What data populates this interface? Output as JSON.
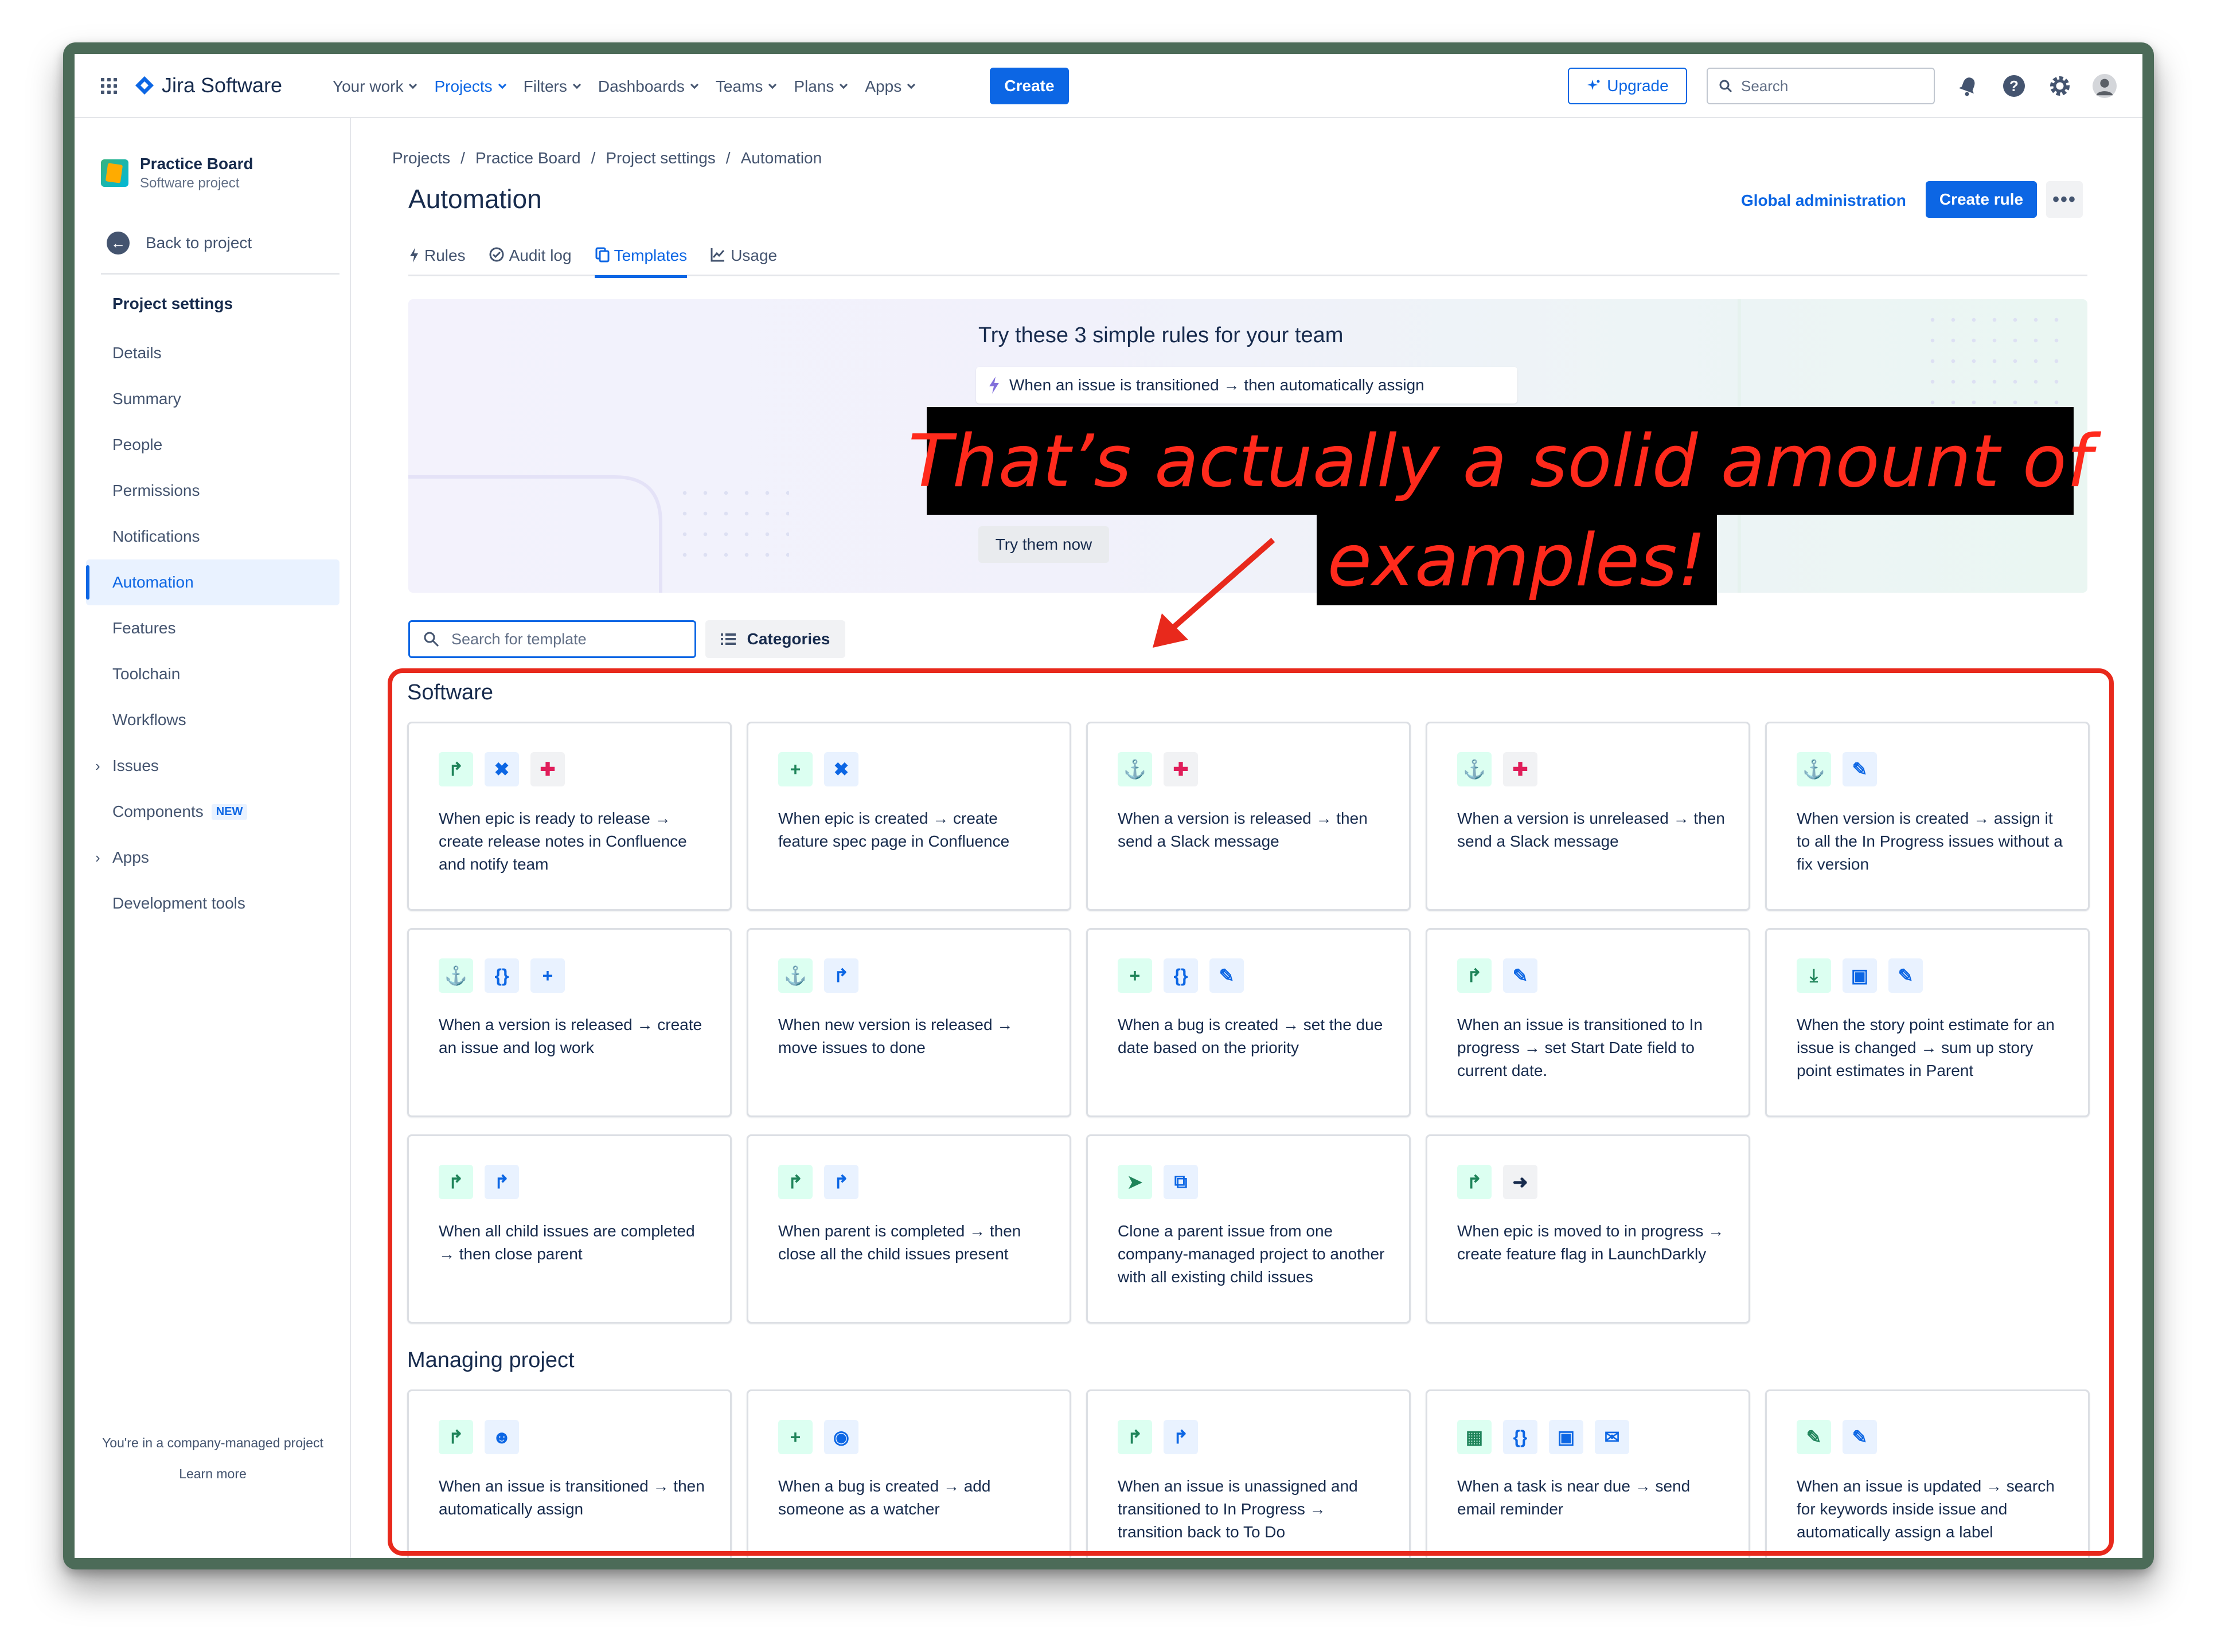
{
  "topnav": {
    "product_name": "Jira Software",
    "menu": [
      {
        "label": "Your work"
      },
      {
        "label": "Projects"
      },
      {
        "label": "Filters"
      },
      {
        "label": "Dashboards"
      },
      {
        "label": "Teams"
      },
      {
        "label": "Plans"
      },
      {
        "label": "Apps"
      }
    ],
    "create_label": "Create",
    "upgrade_label": "Upgrade",
    "search_placeholder": "Search"
  },
  "sidebar": {
    "project_name": "Practice Board",
    "project_type": "Software project",
    "back_label": "Back to project",
    "section_title": "Project settings",
    "items": [
      {
        "label": "Details"
      },
      {
        "label": "Summary"
      },
      {
        "label": "People"
      },
      {
        "label": "Permissions"
      },
      {
        "label": "Notifications"
      },
      {
        "label": "Automation"
      },
      {
        "label": "Features"
      },
      {
        "label": "Toolchain"
      },
      {
        "label": "Workflows"
      },
      {
        "label": "Issues"
      },
      {
        "label": "Components",
        "badge": "NEW"
      },
      {
        "label": "Apps"
      },
      {
        "label": "Development tools"
      }
    ],
    "footer_text": "You're in a company-managed project",
    "footer_link": "Learn more"
  },
  "breadcrumb": [
    "Projects",
    "Practice Board",
    "Project settings",
    "Automation"
  ],
  "page": {
    "title": "Automation",
    "global_admin_label": "Global administration",
    "create_rule_label": "Create rule",
    "more_label": "•••"
  },
  "tabs": [
    {
      "label": "Rules"
    },
    {
      "label": "Audit log"
    },
    {
      "label": "Templates"
    },
    {
      "label": "Usage"
    }
  ],
  "banner": {
    "title": "Try these 3 simple rules for your team",
    "rule_text": "When an issue is transitioned → then automatically assign",
    "button_label": "Try them now"
  },
  "template_search_placeholder": "Search for template",
  "categories_label": "Categories",
  "sections": {
    "software": {
      "title": "Software",
      "cards": [
        {
          "text": "When epic is ready to release → create release notes in Confluence and notify team"
        },
        {
          "text": "When epic is created → create feature spec page in Confluence"
        },
        {
          "text": "When a version is released → then send a Slack message"
        },
        {
          "text": "When a version is unreleased → then send a Slack message"
        },
        {
          "text": "When version is created → assign it to all the In Progress issues without a fix version"
        },
        {
          "text": "When a version is released → create an issue and log work"
        },
        {
          "text": "When new version is released → move issues to done"
        },
        {
          "text": "When a bug is created → set the due date based on the priority"
        },
        {
          "text": "When an issue is transitioned to In progress → set Start Date field to current date."
        },
        {
          "text": "When the story point estimate for an issue is changed → sum up story point estimates in Parent"
        },
        {
          "text": "When all child issues are completed → then close parent"
        },
        {
          "text": "When parent is completed → then close all the child issues present"
        },
        {
          "text": "Clone a parent issue from one company-managed project to another with all existing child issues"
        },
        {
          "text": "When epic is moved to in progress → create feature flag in LaunchDarkly"
        }
      ]
    },
    "managing": {
      "title": "Managing project",
      "cards": [
        {
          "text": "When an issue is transitioned → then automatically assign"
        },
        {
          "text": "When a bug is created → add someone as a watcher"
        },
        {
          "text": "When an issue is unassigned and transitioned to In Progress → transition back to To Do"
        },
        {
          "text": "When a task is near due → send email reminder"
        },
        {
          "text": "When an issue is updated → search for keywords inside issue and automatically assign a label"
        }
      ]
    }
  },
  "annotation": {
    "line1": "That’s actually a solid amount of",
    "line2": "examples!",
    "color": "#e8291c"
  }
}
